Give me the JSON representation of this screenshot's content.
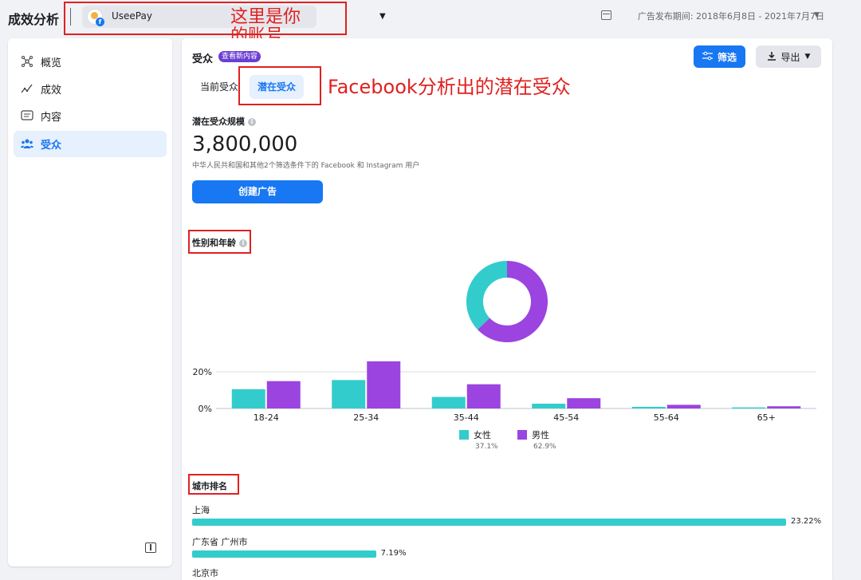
{
  "header": {
    "title": "成效分析",
    "account_name": "UseePay",
    "account_note": "这里是你的账号",
    "date_range": "广告发布期间: 2018年6月8日 - 2021年7月7日"
  },
  "sidebar": {
    "items": [
      {
        "label": "概览",
        "icon": "graph-nodes-icon"
      },
      {
        "label": "成效",
        "icon": "trend-line-icon"
      },
      {
        "label": "内容",
        "icon": "content-cards-icon"
      },
      {
        "label": "受众",
        "icon": "people-icon",
        "active": true
      }
    ]
  },
  "panel": {
    "title": "受众",
    "badge": "查看新内容",
    "filter_label": "筛选",
    "export_label": "导出",
    "tabs": [
      {
        "label": "当前受众",
        "active": false
      },
      {
        "label": "潜在受众",
        "active": true
      }
    ],
    "tab_note": "Facebook分析出的潜在受众",
    "potential_size_label": "潜在受众规模",
    "potential_size_value": "3,800,000",
    "potential_size_desc": "中华人民共和国和其他2个筛选条件下的 Facebook 和 Instagram 用户",
    "create_ad_label": "创建广告",
    "gender_age_title": "性别和年龄",
    "city_rank_title": "城市排名"
  },
  "colors": {
    "female": "#33cccc",
    "male": "#9b44e0",
    "accent": "#1877f2",
    "annotation": "#e02020"
  },
  "chart_data": [
    {
      "type": "pie",
      "labels": [
        "女性",
        "男性"
      ],
      "values": [
        37.1,
        62.9
      ]
    },
    {
      "type": "bar",
      "categories": [
        "18-24",
        "25-34",
        "35-44",
        "45-54",
        "55-64",
        "65+"
      ],
      "series": [
        {
          "name": "女性",
          "values": [
            10.5,
            15.5,
            6.3,
            2.6,
            0.9,
            0.6
          ]
        },
        {
          "name": "男性",
          "values": [
            14.9,
            25.7,
            13.2,
            5.6,
            2.0,
            1.2
          ]
        }
      ],
      "yticks": [
        "0%",
        "20%"
      ],
      "ylim": [
        0,
        30
      ],
      "grid": true,
      "legend": [
        {
          "name": "女性",
          "pct": "37.1%"
        },
        {
          "name": "男性",
          "pct": "62.9%"
        }
      ]
    },
    {
      "type": "bar",
      "orientation": "horizontal",
      "categories": [
        "上海",
        "广东省 广州市",
        "北京市"
      ],
      "values": [
        23.22,
        7.19,
        null
      ],
      "value_labels": [
        "23.22%",
        "7.19%",
        ""
      ]
    }
  ]
}
